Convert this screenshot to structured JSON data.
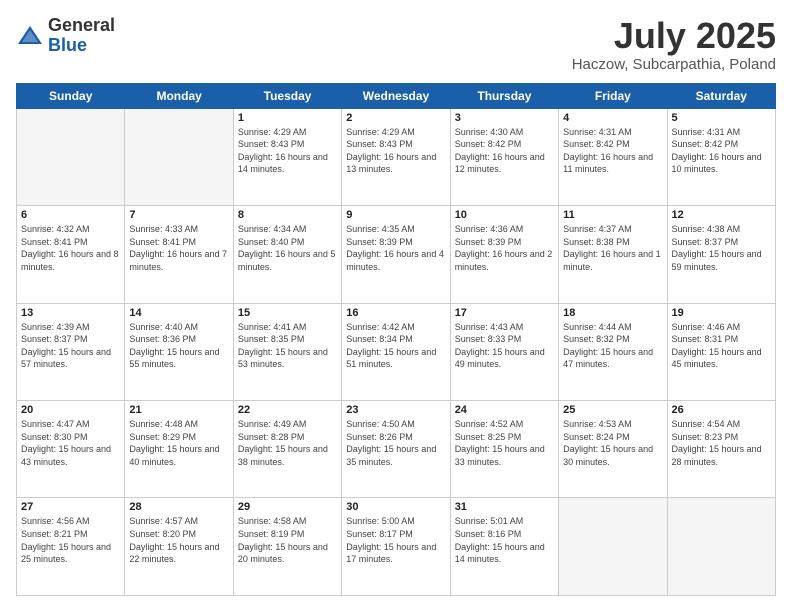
{
  "logo": {
    "general": "General",
    "blue": "Blue"
  },
  "header": {
    "month": "July 2025",
    "location": "Haczow, Subcarpathia, Poland"
  },
  "weekdays": [
    "Sunday",
    "Monday",
    "Tuesday",
    "Wednesday",
    "Thursday",
    "Friday",
    "Saturday"
  ],
  "weeks": [
    [
      {
        "day": "",
        "empty": true
      },
      {
        "day": "",
        "empty": true
      },
      {
        "day": "1",
        "sunrise": "4:29 AM",
        "sunset": "8:43 PM",
        "daylight": "16 hours and 14 minutes."
      },
      {
        "day": "2",
        "sunrise": "4:29 AM",
        "sunset": "8:43 PM",
        "daylight": "16 hours and 13 minutes."
      },
      {
        "day": "3",
        "sunrise": "4:30 AM",
        "sunset": "8:42 PM",
        "daylight": "16 hours and 12 minutes."
      },
      {
        "day": "4",
        "sunrise": "4:31 AM",
        "sunset": "8:42 PM",
        "daylight": "16 hours and 11 minutes."
      },
      {
        "day": "5",
        "sunrise": "4:31 AM",
        "sunset": "8:42 PM",
        "daylight": "16 hours and 10 minutes."
      }
    ],
    [
      {
        "day": "6",
        "sunrise": "4:32 AM",
        "sunset": "8:41 PM",
        "daylight": "16 hours and 8 minutes."
      },
      {
        "day": "7",
        "sunrise": "4:33 AM",
        "sunset": "8:41 PM",
        "daylight": "16 hours and 7 minutes."
      },
      {
        "day": "8",
        "sunrise": "4:34 AM",
        "sunset": "8:40 PM",
        "daylight": "16 hours and 5 minutes."
      },
      {
        "day": "9",
        "sunrise": "4:35 AM",
        "sunset": "8:39 PM",
        "daylight": "16 hours and 4 minutes."
      },
      {
        "day": "10",
        "sunrise": "4:36 AM",
        "sunset": "8:39 PM",
        "daylight": "16 hours and 2 minutes."
      },
      {
        "day": "11",
        "sunrise": "4:37 AM",
        "sunset": "8:38 PM",
        "daylight": "16 hours and 1 minute."
      },
      {
        "day": "12",
        "sunrise": "4:38 AM",
        "sunset": "8:37 PM",
        "daylight": "15 hours and 59 minutes."
      }
    ],
    [
      {
        "day": "13",
        "sunrise": "4:39 AM",
        "sunset": "8:37 PM",
        "daylight": "15 hours and 57 minutes."
      },
      {
        "day": "14",
        "sunrise": "4:40 AM",
        "sunset": "8:36 PM",
        "daylight": "15 hours and 55 minutes."
      },
      {
        "day": "15",
        "sunrise": "4:41 AM",
        "sunset": "8:35 PM",
        "daylight": "15 hours and 53 minutes."
      },
      {
        "day": "16",
        "sunrise": "4:42 AM",
        "sunset": "8:34 PM",
        "daylight": "15 hours and 51 minutes."
      },
      {
        "day": "17",
        "sunrise": "4:43 AM",
        "sunset": "8:33 PM",
        "daylight": "15 hours and 49 minutes."
      },
      {
        "day": "18",
        "sunrise": "4:44 AM",
        "sunset": "8:32 PM",
        "daylight": "15 hours and 47 minutes."
      },
      {
        "day": "19",
        "sunrise": "4:46 AM",
        "sunset": "8:31 PM",
        "daylight": "15 hours and 45 minutes."
      }
    ],
    [
      {
        "day": "20",
        "sunrise": "4:47 AM",
        "sunset": "8:30 PM",
        "daylight": "15 hours and 43 minutes."
      },
      {
        "day": "21",
        "sunrise": "4:48 AM",
        "sunset": "8:29 PM",
        "daylight": "15 hours and 40 minutes."
      },
      {
        "day": "22",
        "sunrise": "4:49 AM",
        "sunset": "8:28 PM",
        "daylight": "15 hours and 38 minutes."
      },
      {
        "day": "23",
        "sunrise": "4:50 AM",
        "sunset": "8:26 PM",
        "daylight": "15 hours and 35 minutes."
      },
      {
        "day": "24",
        "sunrise": "4:52 AM",
        "sunset": "8:25 PM",
        "daylight": "15 hours and 33 minutes."
      },
      {
        "day": "25",
        "sunrise": "4:53 AM",
        "sunset": "8:24 PM",
        "daylight": "15 hours and 30 minutes."
      },
      {
        "day": "26",
        "sunrise": "4:54 AM",
        "sunset": "8:23 PM",
        "daylight": "15 hours and 28 minutes."
      }
    ],
    [
      {
        "day": "27",
        "sunrise": "4:56 AM",
        "sunset": "8:21 PM",
        "daylight": "15 hours and 25 minutes."
      },
      {
        "day": "28",
        "sunrise": "4:57 AM",
        "sunset": "8:20 PM",
        "daylight": "15 hours and 22 minutes."
      },
      {
        "day": "29",
        "sunrise": "4:58 AM",
        "sunset": "8:19 PM",
        "daylight": "15 hours and 20 minutes."
      },
      {
        "day": "30",
        "sunrise": "5:00 AM",
        "sunset": "8:17 PM",
        "daylight": "15 hours and 17 minutes."
      },
      {
        "day": "31",
        "sunrise": "5:01 AM",
        "sunset": "8:16 PM",
        "daylight": "15 hours and 14 minutes."
      },
      {
        "day": "",
        "empty": true
      },
      {
        "day": "",
        "empty": true
      }
    ]
  ]
}
